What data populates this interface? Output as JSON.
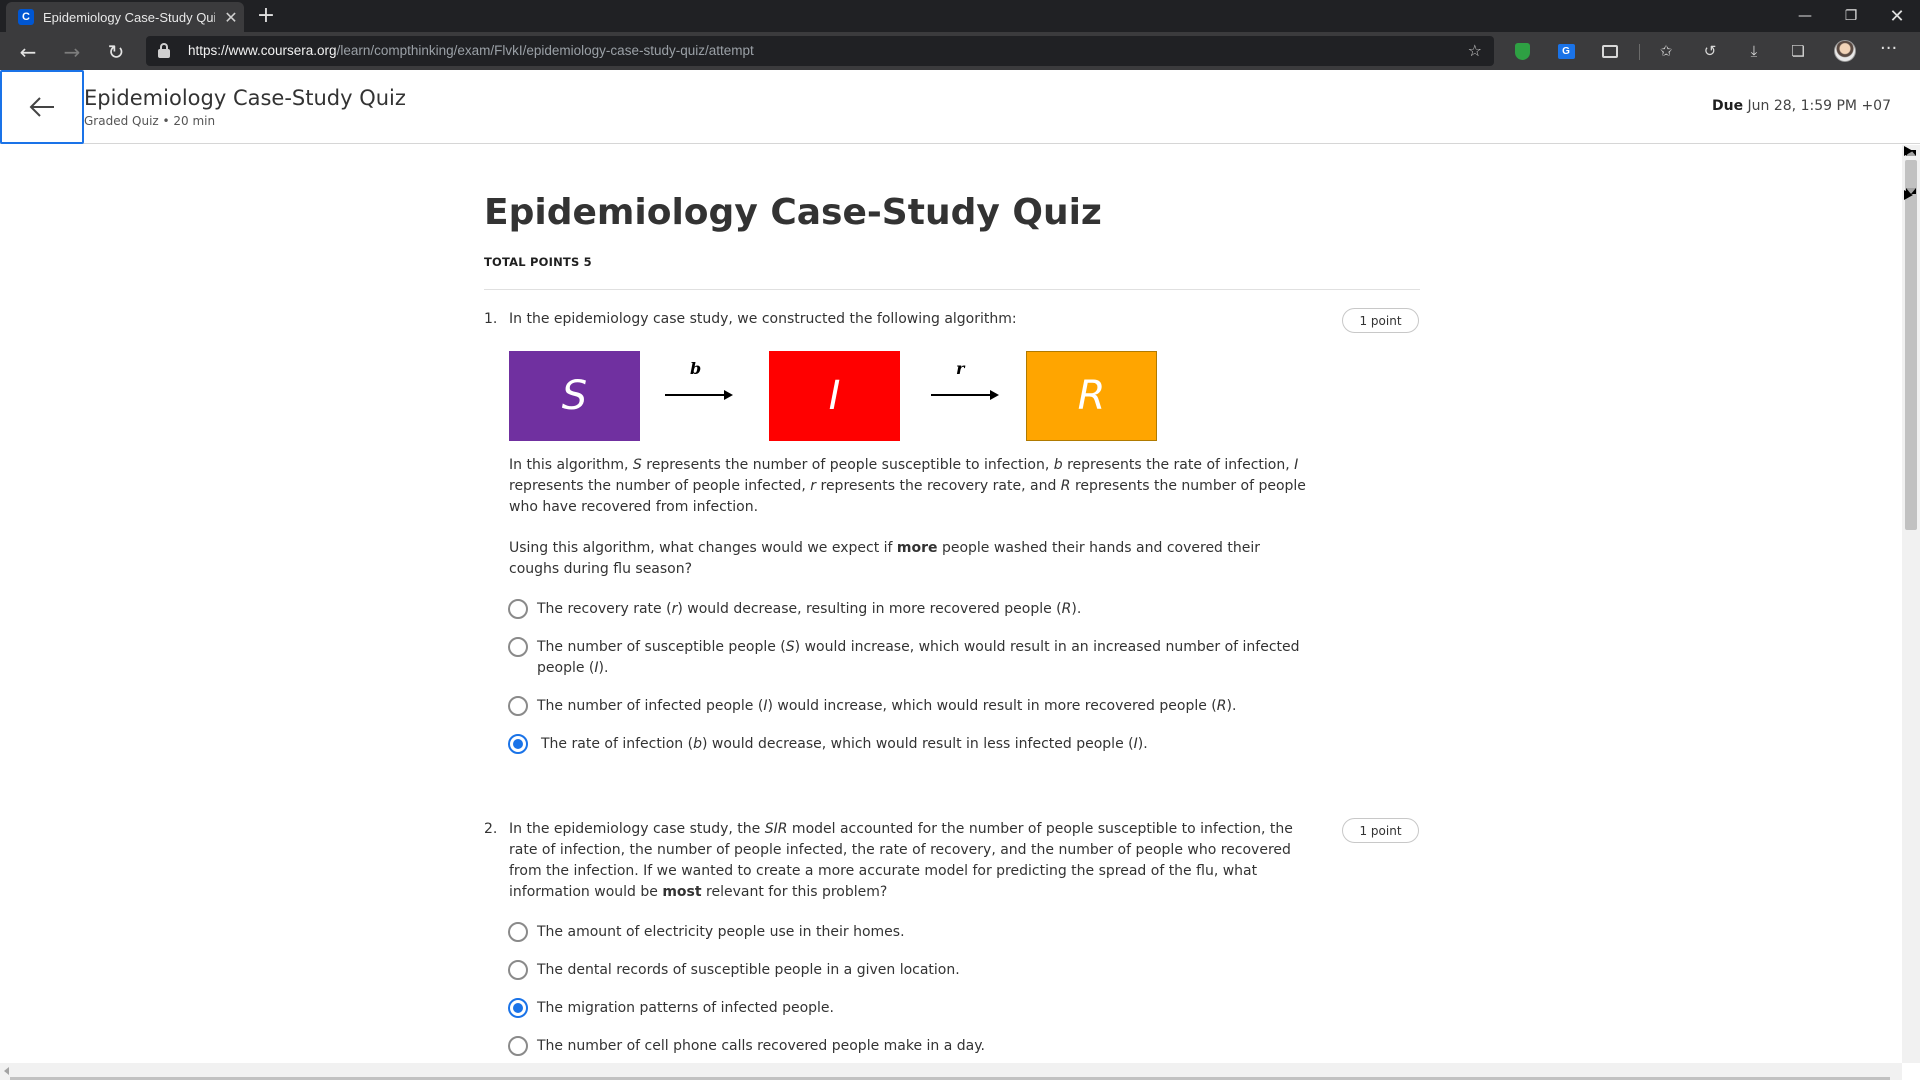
{
  "browser": {
    "tab_title": "Epidemiology Case-Study Quiz |",
    "tab_favicon": "C",
    "url_host": "https://www.coursera.org",
    "url_path": "/learn/compthinking/exam/FlvkI/epidemiology-case-study-quiz/attempt",
    "icons": [
      "back-icon",
      "forward-icon",
      "reload-icon",
      "lock-icon",
      "favorite-star-icon",
      "shield-extension-icon",
      "translate-extension-icon",
      "extension-icon",
      "favorites-icon",
      "history-icon",
      "download-icon",
      "collections-icon",
      "profile-avatar",
      "more-icon"
    ]
  },
  "header": {
    "title": "Epidemiology Case-Study Quiz",
    "subtitle": "Graded Quiz • 20 min",
    "due_label": "Due",
    "due_value": "Jun 28, 1:59 PM +07"
  },
  "quiz": {
    "title": "Epidemiology Case-Study Quiz",
    "total_points": "TOTAL POINTS 5",
    "accent_color": "#1a73e8"
  },
  "q1": {
    "number": "1.",
    "prompt": "In the epidemiology case study, we constructed the following algorithm:",
    "points": "1 point",
    "diagram": {
      "s": "S",
      "i": "I",
      "r": "R",
      "b": "b",
      "rate_r": "r",
      "colors": {
        "s": "#7030a0",
        "i": "#ff0000",
        "r": "#ffa500"
      }
    },
    "explanation": [
      "In this algorithm, ",
      "S",
      " represents the number of people susceptible to infection, ",
      "b",
      " represents the rate of infection, ",
      "I",
      " represents the number of people infected, ",
      "r",
      " represents the recovery rate, and ",
      "R",
      " represents the number of people who have recovered from infection."
    ],
    "question_pre": "Using this algorithm, what changes would we expect if ",
    "question_bold": "more",
    "question_post": " people washed their hands and covered their coughs during flu season?",
    "options": [
      {
        "pre": "The recovery rate (",
        "v1": "r",
        "mid": ") would decrease, resulting in more recovered people (",
        "v2": "R",
        "post": ").",
        "selected": false
      },
      {
        "pre": "The number of susceptible people (",
        "v1": "S",
        "mid": ") would increase, which would result in an increased number of infected people (",
        "v2": "I",
        "post": ").",
        "selected": false
      },
      {
        "pre": "The number of infected people (",
        "v1": "I",
        "mid": ") would increase, which would result in more recovered people (",
        "v2": "R",
        "post": ").",
        "selected": false
      },
      {
        "pre": "The rate of infection (",
        "v1": "b",
        "mid": ") would decrease, which would result in less infected people (",
        "v2": "I",
        "post": ").",
        "selected": true
      }
    ]
  },
  "q2": {
    "number": "2.",
    "prompt_pre": "In the epidemiology case study, the ",
    "prompt_em": "SIR",
    "prompt_mid": " model accounted for the number of people susceptible to infection, the rate of infection, the number of people infected, the rate of recovery, and the number of people who recovered from the infection. If we wanted to create a more accurate model for predicting the spread of the flu, what information would be ",
    "prompt_bold": "most",
    "prompt_post": " relevant for this problem?",
    "points": "1 point",
    "options": [
      {
        "text": "The amount of electricity people use in their homes.",
        "selected": false
      },
      {
        "text": "The dental records of susceptible people in a given location.",
        "selected": false
      },
      {
        "text": "The migration patterns of infected people.",
        "selected": true
      },
      {
        "text": "The number of cell phone calls recovered people make in a day.",
        "selected": false
      }
    ]
  }
}
